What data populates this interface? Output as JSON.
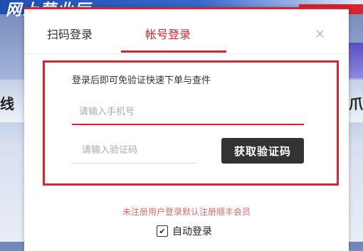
{
  "background": {
    "banner_text": "网上营业厅",
    "left_fragment": "线",
    "right_fragment": "爪"
  },
  "dialog": {
    "tabs": [
      {
        "label": "扫码登录",
        "active": false
      },
      {
        "label": "帐号登录",
        "active": true
      }
    ],
    "close_icon": "×",
    "hint": "登录后即可免验证快速下单与查件",
    "phone_placeholder": "请输入手机号",
    "code_placeholder": "请输入验证码",
    "get_code_button": "获取验证码",
    "notice": "未注册用户登录默认注册顺丰会员",
    "auto_login": {
      "label": "自动登录",
      "checked": true,
      "check_mark": "✔"
    }
  },
  "colors": {
    "accent": "#d9232d",
    "button_bg": "#333333",
    "notice_text": "#d96a6a"
  }
}
